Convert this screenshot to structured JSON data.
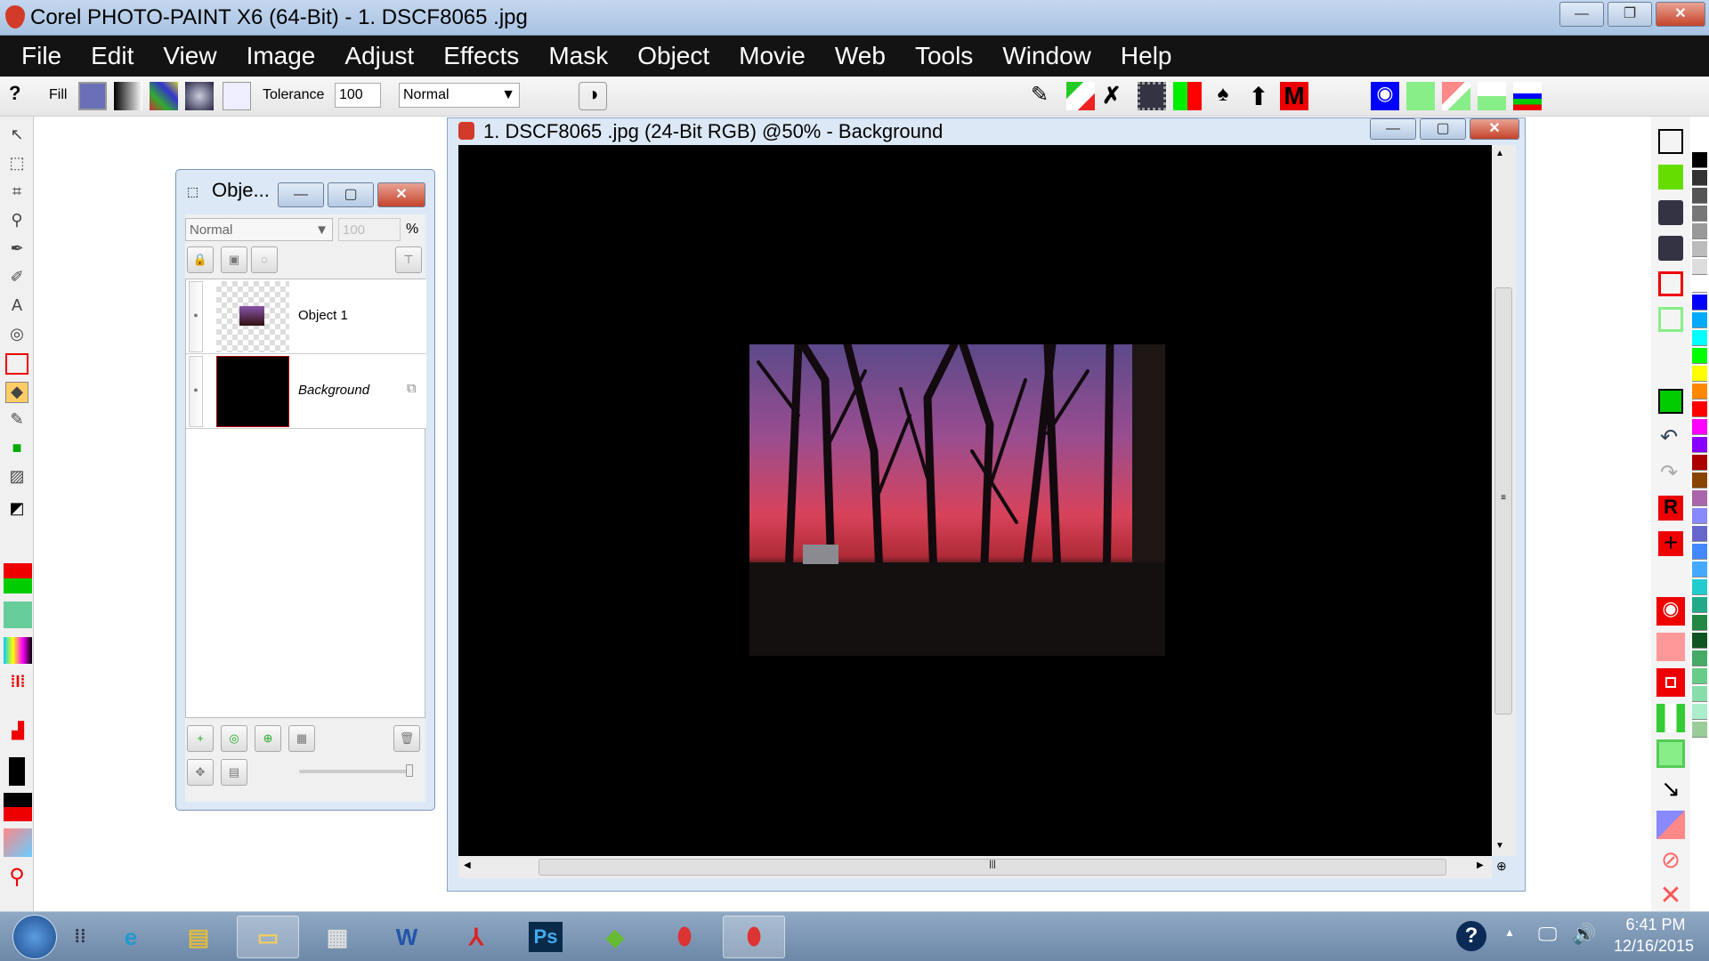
{
  "app": {
    "title": "Corel PHOTO-PAINT X6 (64-Bit) - 1. DSCF8065  .jpg"
  },
  "menu": [
    "File",
    "Edit",
    "View",
    "Image",
    "Adjust",
    "Effects",
    "Mask",
    "Object",
    "Movie",
    "Web",
    "Tools",
    "Window",
    "Help"
  ],
  "toolbar": {
    "fill_label": "Fill",
    "fill_color": "#6b6fb8",
    "tolerance_label": "Tolerance",
    "tolerance_value": "100",
    "mode_value": "Normal"
  },
  "docker": {
    "title": "Obje...",
    "mode_value": "Normal",
    "opacity_value": "100",
    "opacity_unit": "%",
    "layers": [
      {
        "name": "Object 1"
      },
      {
        "name": "Background"
      }
    ]
  },
  "image_window": {
    "title": "1. DSCF8065  .jpg (24-Bit RGB) @50% - Background"
  },
  "taskbar": {
    "time": "6:41 PM",
    "date": "12/16/2015",
    "apps": [
      "ie",
      "explorer",
      "files",
      "calculator",
      "word",
      "acrobat",
      "photoshop",
      "corel-draw",
      "corel-photo-paint",
      "corel-photo-paint-active"
    ]
  },
  "palette": [
    "#000000",
    "#333333",
    "#555555",
    "#777777",
    "#999999",
    "#bbbbbb",
    "#dddddd",
    "#ffffff",
    "#0000ff",
    "#00aaff",
    "#00ffff",
    "#00ff00",
    "#ffff00",
    "#ff8800",
    "#ff0000",
    "#ff00ff",
    "#8800ff",
    "#aa0000",
    "#884400",
    "#aa66aa",
    "#8888ff",
    "#6666cc",
    "#4488ff",
    "#44aaff",
    "#22cccc",
    "#22aa88",
    "#228844",
    "#115522",
    "#44aa66",
    "#66cc88",
    "#88ddaa",
    "#aaeecc",
    "#99cc99"
  ]
}
